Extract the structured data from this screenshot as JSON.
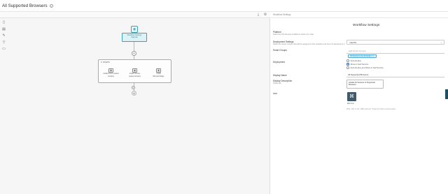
{
  "title": "All Supported Browsers",
  "title_info_icon": "info-icon",
  "canvas": {
    "toolbar_icons": [
      "download-icon",
      "settings-icon"
    ],
    "left_tools": [
      "file-icon",
      "copy-icon",
      "pen-icon",
      "filter-icon",
      "folder-icon"
    ],
    "trigger": {
      "line1": "Workflow Settings",
      "line2": "Capsule"
    },
    "group_label": "STEPS",
    "steps": [
      {
        "line1": "Install Firefox (Latest",
        "line2": "Version)"
      },
      {
        "line1": "Install Chrome",
        "line2": "(Latest Version)"
      },
      {
        "line1": "Install",
        "line2": "Microsoft Edge"
      }
    ]
  },
  "panel": {
    "crumb": "Workflow Settings",
    "heading": "Workflow Settings",
    "platform_label": "Platform",
    "platform_sub": "Select the OS that this workflow is written for. Note.",
    "platform_value": "macOS",
    "deployment_settings_label": "Deployment Settings",
    "deployment_settings_sub": "Select the Smart Groups that will be assigned to this workflow and how it is delivered to it.",
    "smart_groups_label": "Smart Groups",
    "smart_groups_placeholder": "Add Smart Groups",
    "smart_group_tag": "All Devices (Live Exclude) 1",
    "deployment_label": "Deployment",
    "deployment_options": [
      "Auto-Deploy",
      "Show in Self Service",
      "Auto-Deploy and Show in Self Service"
    ],
    "deployment_selected_index": 1,
    "display_name_label": "Display Name",
    "display_name_value": "All Supported Browsers",
    "display_description_label": "Display Description",
    "display_description_sub": "(Optional)",
    "display_description_value": "Installs All Versions of Supported Browsers",
    "icon_label": "Icon",
    "icon_edit": "Edit Icon",
    "icon_hint": "PNG, JPG or GIF. 1MB maximum. 512px by 512px recommended."
  }
}
